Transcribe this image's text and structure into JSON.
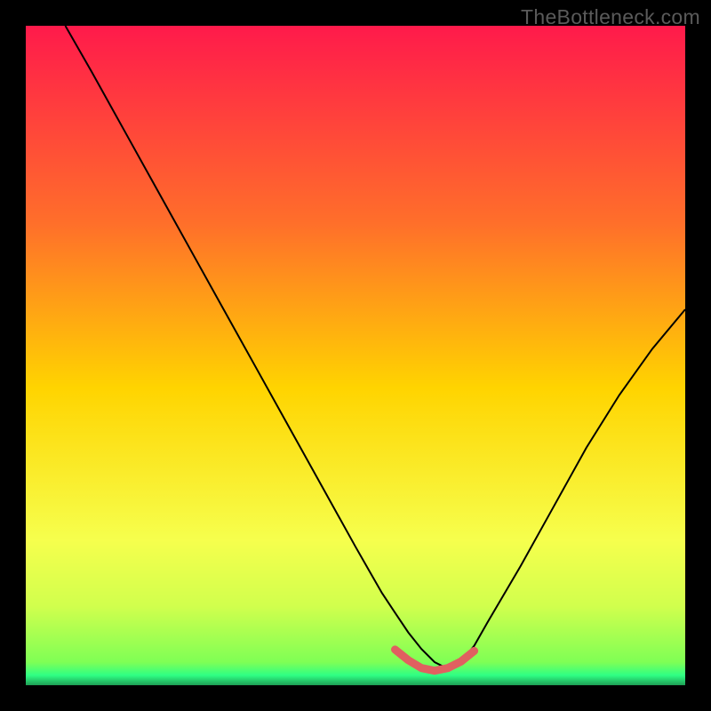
{
  "watermark": "TheBottleneck.com",
  "chart_data": {
    "type": "line",
    "title": "",
    "xlabel": "",
    "ylabel": "",
    "xlim": [
      0,
      100
    ],
    "ylim": [
      0,
      100
    ],
    "grid": false,
    "gradient_stops": [
      {
        "pos": 0.0,
        "color": "#ff1a4b"
      },
      {
        "pos": 0.3,
        "color": "#ff6f2a"
      },
      {
        "pos": 0.55,
        "color": "#ffd400"
      },
      {
        "pos": 0.78,
        "color": "#f6ff4d"
      },
      {
        "pos": 0.88,
        "color": "#d1ff4d"
      },
      {
        "pos": 0.965,
        "color": "#7fff55"
      },
      {
        "pos": 0.985,
        "color": "#2fff84"
      },
      {
        "pos": 1.0,
        "color": "#1e9e55"
      }
    ],
    "series": [
      {
        "name": "curve",
        "stroke": "#000000",
        "stroke_width": 2,
        "x": [
          6,
          10,
          15,
          20,
          25,
          30,
          35,
          40,
          45,
          50,
          52,
          54,
          56,
          58,
          60,
          62,
          64,
          66,
          68,
          70,
          75,
          80,
          85,
          90,
          95,
          100
        ],
        "y_pct": [
          100,
          93,
          84,
          75,
          66,
          57,
          48,
          39,
          30,
          21,
          17.5,
          14,
          11,
          8,
          5.5,
          3.5,
          2.5,
          3.5,
          6,
          9.5,
          18,
          27,
          36,
          44,
          51,
          57
        ]
      },
      {
        "name": "floor-highlight",
        "stroke": "#e06060",
        "stroke_width": 9,
        "linecap": "round",
        "x": [
          56,
          58,
          60,
          62,
          64,
          66,
          68
        ],
        "y_pct": [
          5.4,
          3.8,
          2.6,
          2.2,
          2.6,
          3.6,
          5.2
        ]
      }
    ]
  }
}
